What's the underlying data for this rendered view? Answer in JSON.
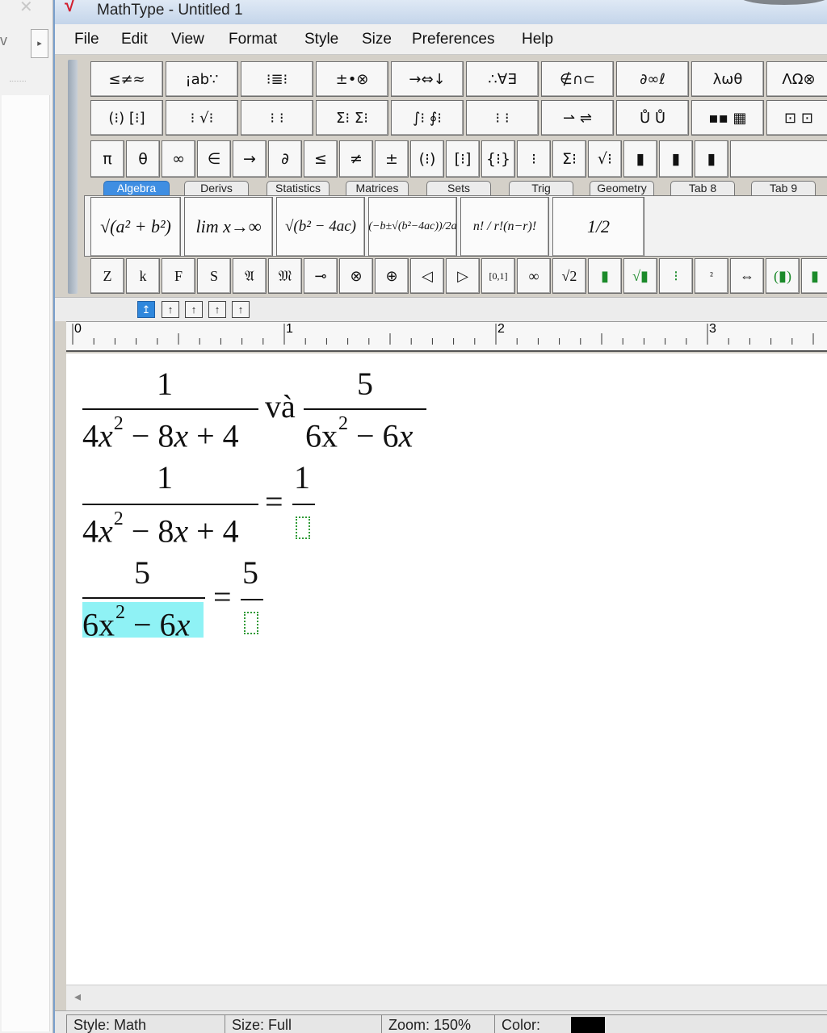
{
  "app": {
    "title": "MathType - Untitled 1"
  },
  "menu": [
    "File",
    "Edit",
    "View",
    "Format",
    "Style",
    "Size",
    "Preferences",
    "Help"
  ],
  "toolbar": {
    "row1": [
      "≤≠≈",
      "¡ab∵",
      "⁝≣⁝",
      "±•⊗",
      "→⇔↓",
      "∴∀∃",
      "∉∩⊂",
      "∂∞ℓ",
      "λωθ",
      "ΛΩ⊗"
    ],
    "row2": [
      "(⁝) [⁝]",
      "⁝ √⁝",
      "⁝ ⁝",
      "Σ⁝ Σ⁝",
      "∫⁝ ∮⁝",
      "⁝ ⁝",
      "⇀ ⇌",
      "Ů Ů",
      "▪▪ ▦"
    ],
    "row3": [
      "π",
      "θ",
      "∞",
      "∈",
      "→",
      "∂",
      "≤",
      "≠",
      "±",
      "(⁝)",
      "[⁝]",
      "{⁝}",
      "⁝",
      "Σ⁝",
      "√⁝",
      "▮",
      "▮",
      "▮"
    ],
    "tabs": [
      "Algebra",
      "Derivs",
      "Statistics",
      "Matrices",
      "Sets",
      "Trig",
      "Geometry",
      "Tab 8",
      "Tab 9"
    ],
    "active_tab": "Algebra",
    "templates": [
      "√(a² + b²)",
      "lim x→∞",
      "√(b² − 4ac)",
      "(−b±√(b²−4ac))/2a",
      "n! / r!(n−r)!",
      "1/2"
    ],
    "row5": [
      "Z",
      "k",
      "F",
      "S",
      "𝔄",
      "𝔐",
      "⊸",
      "⊗",
      "⊕",
      "◁",
      "▷",
      "[0,1]",
      "∞",
      "√2",
      "▮",
      "√▮",
      "⁝",
      "²",
      "⇔",
      "(▮)",
      "▮"
    ]
  },
  "nudge_buttons": [
    "↥",
    "↑",
    "↑",
    "↑",
    "↑"
  ],
  "ruler": {
    "labels": [
      "0",
      "1",
      "2",
      "3"
    ]
  },
  "equations": {
    "eq1": {
      "num_a": "1",
      "den_a_pre": "4",
      "den_a_var": "x",
      "den_a_exp": "2",
      "den_a_rest": " − 8",
      "den_a_var2": "x",
      "den_a_end": " + 4",
      "connector": "và",
      "num_b": "5",
      "den_b_pre": "6x",
      "den_b_exp": "2",
      "den_b_rest": " − 6",
      "den_b_var": "x"
    },
    "eq2": {
      "num_a": "1",
      "den_a_pre": "4",
      "den_a_var": "x",
      "den_a_exp": "2",
      "den_a_rest": " − 8",
      "den_a_var2": "x",
      "den_a_end": " + 4",
      "equals": "=",
      "num_b": "1"
    },
    "eq3": {
      "num_a": "5",
      "den_a_pre": "6x",
      "den_a_exp": "2",
      "den_a_rest": " − 6",
      "den_a_var": "x",
      "equals": "=",
      "num_b": "5"
    }
  },
  "status": {
    "style": "Style: Math",
    "size": "Size: Full",
    "zoom": "Zoom: 150%",
    "color": "Color:",
    "color_value": "#000000"
  },
  "colors": {
    "accent": "#3f8ee2",
    "selection": "#8ff2f5",
    "placeholder": "#2f9a36"
  }
}
